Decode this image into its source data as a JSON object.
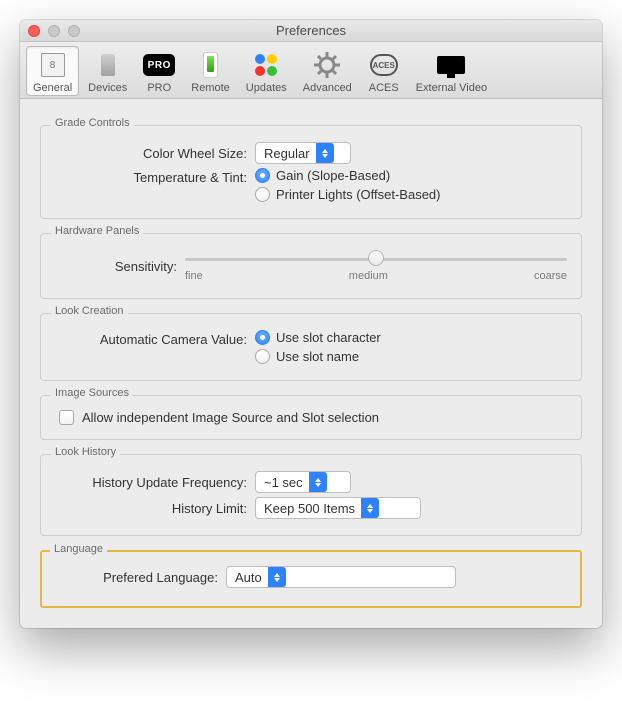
{
  "window": {
    "title": "Preferences"
  },
  "toolbar": {
    "items": [
      {
        "label": "General",
        "icon": "general-icon",
        "selected": true
      },
      {
        "label": "Devices",
        "icon": "devices-icon",
        "selected": false
      },
      {
        "label": "PRO",
        "icon": "pro-icon",
        "selected": false
      },
      {
        "label": "Remote",
        "icon": "remote-icon",
        "selected": false
      },
      {
        "label": "Updates",
        "icon": "updates-icon",
        "selected": false
      },
      {
        "label": "Advanced",
        "icon": "advanced-icon",
        "selected": false
      },
      {
        "label": "ACES",
        "icon": "aces-icon",
        "selected": false
      },
      {
        "label": "External Video",
        "icon": "external-video-icon",
        "selected": false
      }
    ]
  },
  "grade_controls": {
    "legend": "Grade Controls",
    "color_wheel_label": "Color Wheel Size:",
    "color_wheel_value": "Regular",
    "temp_tint_label": "Temperature & Tint:",
    "temp_tint_options": [
      {
        "label": "Gain (Slope-Based)",
        "selected": true
      },
      {
        "label": "Printer Lights (Offset-Based)",
        "selected": false
      }
    ]
  },
  "hardware_panels": {
    "legend": "Hardware Panels",
    "sensitivity_label": "Sensitivity:",
    "ticks": {
      "left": "fine",
      "mid": "medium",
      "right": "coarse"
    },
    "value": "medium"
  },
  "look_creation": {
    "legend": "Look Creation",
    "auto_cam_label": "Automatic Camera Value:",
    "options": [
      {
        "label": "Use slot character",
        "selected": true
      },
      {
        "label": "Use slot name",
        "selected": false
      }
    ]
  },
  "image_sources": {
    "legend": "Image Sources",
    "checkbox_label": "Allow independent Image Source and Slot selection",
    "checked": false
  },
  "look_history": {
    "legend": "Look History",
    "freq_label": "History Update Frequency:",
    "freq_value": "~1 sec",
    "limit_label": "History Limit:",
    "limit_value": "Keep 500 Items"
  },
  "language": {
    "legend": "Language",
    "label": "Prefered Language:",
    "value": "Auto"
  }
}
